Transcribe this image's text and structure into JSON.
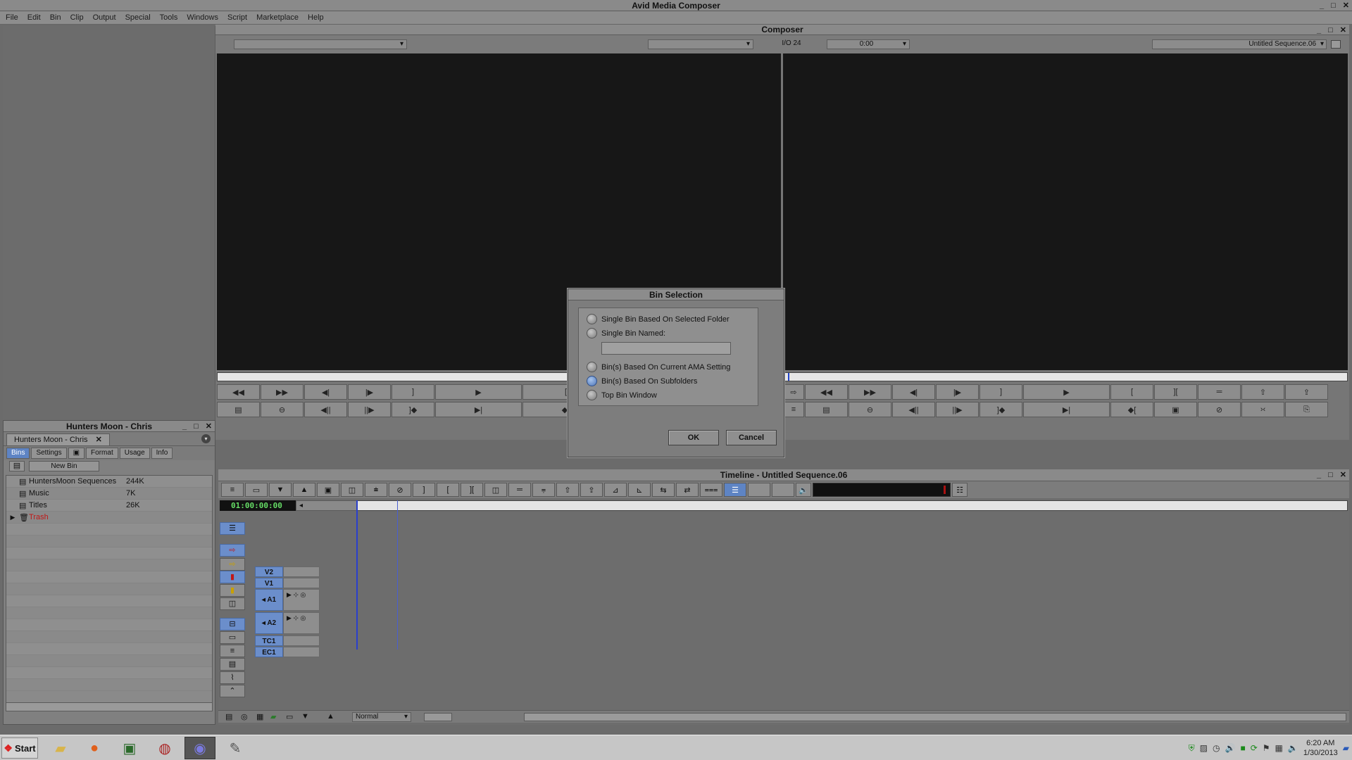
{
  "app": {
    "title": "Avid Media Composer",
    "window_controls": [
      "_",
      "□",
      "✕"
    ]
  },
  "menu": [
    "File",
    "Edit",
    "Bin",
    "Clip",
    "Output",
    "Special",
    "Tools",
    "Windows",
    "Script",
    "Marketplace",
    "Help"
  ],
  "composer": {
    "title": "Composer",
    "center_readout_left": "I/O 24",
    "center_readout_right": "0:00",
    "sequence_name": "Untitled Sequence.06"
  },
  "bin_window": {
    "title": "Hunters Moon - Chris",
    "tab": "Hunters Moon - Chris",
    "subtabs": [
      "Bins",
      "Settings",
      "▣",
      "Format",
      "Usage",
      "Info"
    ],
    "active_subtab": "Bins",
    "new_bin": "New Bin",
    "items": [
      {
        "name": "HuntersMoon Sequences",
        "size": "244K",
        "color": "#111111"
      },
      {
        "name": "Music",
        "size": "7K",
        "color": "#111111"
      },
      {
        "name": "Titles",
        "size": "26K",
        "color": "#111111"
      },
      {
        "name": "Trash",
        "size": "",
        "color": "#c01818"
      }
    ]
  },
  "timeline": {
    "title": "Timeline - Untitled Sequence.06",
    "timecode": "01:00:00:00",
    "tracks": [
      "V2",
      "V1",
      "◂ A1",
      "◂ A2",
      "TC1",
      "EC1"
    ],
    "zoom_mode": "Normal"
  },
  "dialog": {
    "title": "Bin Selection",
    "options": [
      {
        "label": "Single Bin Based On Selected Folder",
        "selected": false
      },
      {
        "label": "Single Bin Named:",
        "selected": false
      },
      {
        "label": "Bin(s) Based On Current AMA Setting",
        "selected": false
      },
      {
        "label": "Bin(s) Based On Subfolders",
        "selected": true
      },
      {
        "label": "Top Bin Window",
        "selected": false
      }
    ],
    "bin_name_value": "",
    "ok": "OK",
    "cancel": "Cancel"
  },
  "taskbar": {
    "start": "Start",
    "apps": [
      "folder-icon",
      "firefox-icon",
      "monitor-icon",
      "avid-icon",
      "composer-icon",
      "gimp-icon"
    ],
    "time": "6:20 AM",
    "date": "1/30/2013"
  },
  "colors": {
    "accent": "#5e84c4",
    "track_blue": "#6b8ecb",
    "timecode_green": "#66dd66",
    "trash_red": "#c01818"
  }
}
